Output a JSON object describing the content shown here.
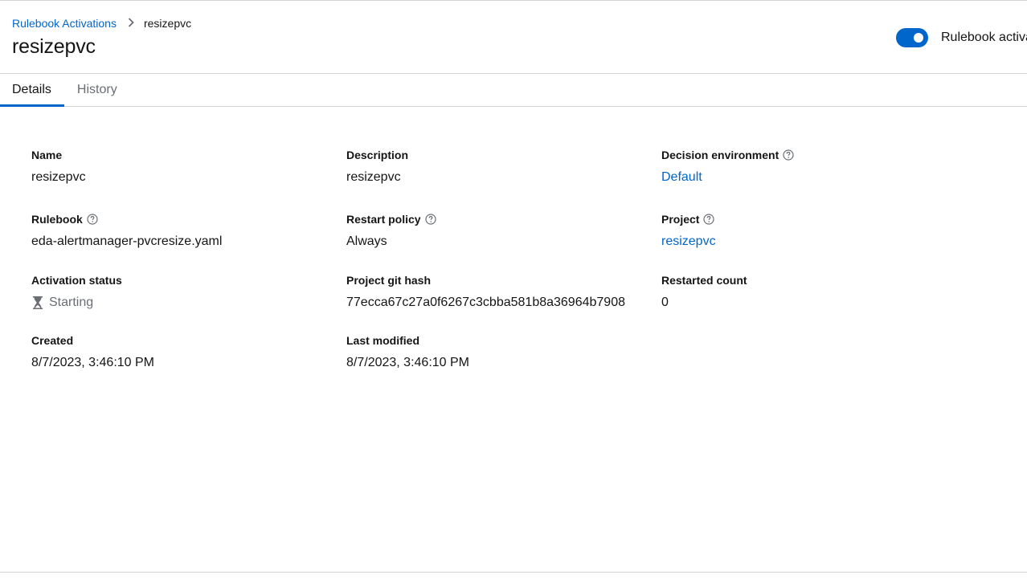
{
  "breadcrumb": {
    "parent": "Rulebook Activations",
    "current": "resizepvc"
  },
  "header": {
    "title": "resizepvc",
    "toggle_label": "Rulebook activa",
    "toggle_on": true
  },
  "tabs": [
    {
      "label": "Details",
      "active": true
    },
    {
      "label": "History",
      "active": false
    }
  ],
  "details": {
    "name": {
      "label": "Name",
      "value": "resizepvc"
    },
    "description": {
      "label": "Description",
      "value": "resizepvc"
    },
    "decision_environment": {
      "label": "Decision environment",
      "value": "Default"
    },
    "rulebook": {
      "label": "Rulebook",
      "value": "eda-alertmanager-pvcresize.yaml"
    },
    "restart_policy": {
      "label": "Restart policy",
      "value": "Always"
    },
    "project": {
      "label": "Project",
      "value": "resizepvc"
    },
    "activation_status": {
      "label": "Activation status",
      "value": "Starting",
      "icon": "hourglass-icon"
    },
    "project_git_hash": {
      "label": "Project git hash",
      "value": "77ecca67c27a0f6267c3cbba581b8a36964b7908"
    },
    "restarted_count": {
      "label": "Restarted count",
      "value": "0"
    },
    "created": {
      "label": "Created",
      "value": "8/7/2023, 3:46:10 PM"
    },
    "last_modified": {
      "label": "Last modified",
      "value": "8/7/2023, 3:46:10 PM"
    }
  },
  "colors": {
    "link": "#0066cc",
    "toggle": "#0066cc",
    "muted": "#6a6e73",
    "border": "#d2d2d2"
  }
}
